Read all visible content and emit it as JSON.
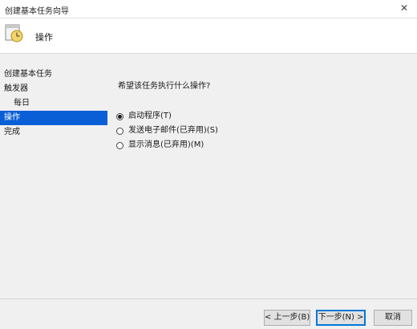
{
  "window": {
    "title": "创建基本任务向导",
    "close_glyph": "✕"
  },
  "header": {
    "title": "操作",
    "icon": "task-clock-icon"
  },
  "nav": {
    "items": [
      {
        "label": "创建基本任务",
        "indent": false,
        "active": false
      },
      {
        "label": "触发器",
        "indent": false,
        "active": false
      },
      {
        "label": "每日",
        "indent": true,
        "active": false
      },
      {
        "label": "操作",
        "indent": false,
        "active": true
      },
      {
        "label": "完成",
        "indent": false,
        "active": false
      }
    ]
  },
  "main": {
    "prompt": "希望该任务执行什么操作?",
    "options": [
      {
        "label": "启动程序(T)",
        "checked": true
      },
      {
        "label": "发送电子邮件(已弃用)(S)",
        "checked": false
      },
      {
        "label": "显示消息(已弃用)(M)",
        "checked": false
      }
    ]
  },
  "buttons": {
    "back": "< 上一步(B)",
    "next": "下一步(N) >",
    "cancel": "取消"
  },
  "colors": {
    "accent": "#0a5fd6",
    "window_bg": "#f0f0f0",
    "header_bg": "#ffffff"
  }
}
